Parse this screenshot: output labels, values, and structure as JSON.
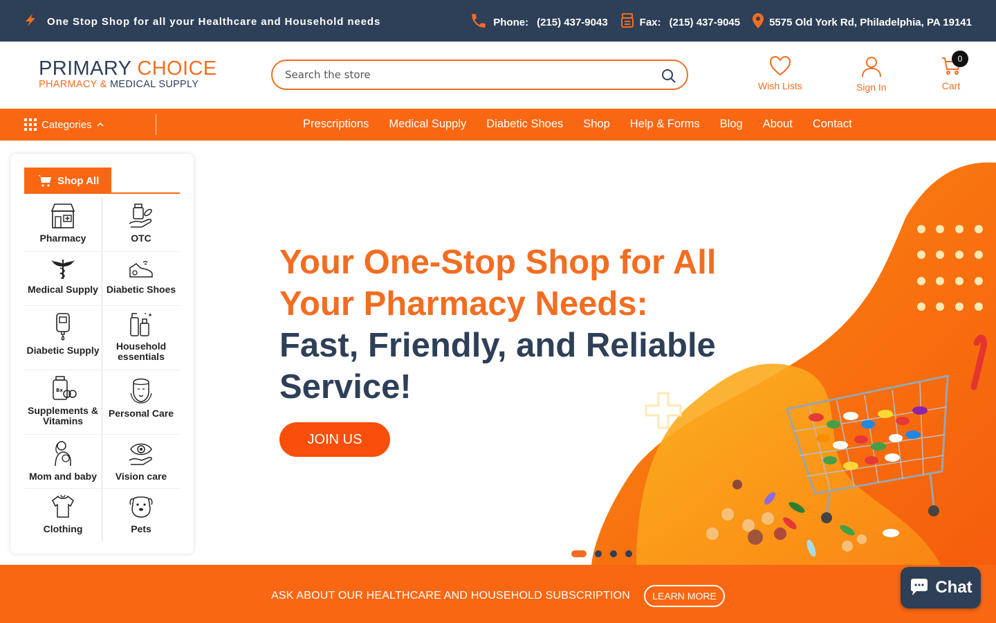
{
  "topbar": {
    "promo": "One Stop Shop for all your Healthcare and Household needs",
    "phone_label": "Phone:",
    "phone": "(215) 437-9043",
    "fax_label": "Fax:",
    "fax": "(215) 437-9045",
    "address": "5575 Old York Rd, Philadelphia, PA 19141"
  },
  "logo": {
    "line1_a": "PRIMARY",
    "line1_b": "CHOICE",
    "line2_a": "PHARMACY",
    "line2_amp": "&",
    "line2_b": "MEDICAL SUPPLY"
  },
  "search": {
    "placeholder": "Search the store"
  },
  "header": {
    "wishlist": "Wish Lists",
    "signin": "Sign In",
    "cart": "Cart",
    "cart_count": "0"
  },
  "nav": {
    "categories": "Categories",
    "links": [
      "Prescriptions",
      "Medical Supply",
      "Diabetic Shoes",
      "Shop",
      "Help & Forms",
      "Blog",
      "About",
      "Contact"
    ]
  },
  "sidebar": {
    "shop_all": "Shop All",
    "categories": [
      {
        "label": "Pharmacy",
        "icon": "pharmacy-store-icon"
      },
      {
        "label": "OTC",
        "icon": "pill-bottle-hand-icon"
      },
      {
        "label": "Medical Supply",
        "icon": "caduceus-icon"
      },
      {
        "label": "Diabetic Shoes",
        "icon": "shoe-icon"
      },
      {
        "label": "Diabetic Supply",
        "icon": "glucometer-icon"
      },
      {
        "label": "Household essentials",
        "icon": "cleaning-bottles-icon"
      },
      {
        "label": "Supplements & Vitamins",
        "icon": "supplements-jar-icon"
      },
      {
        "label": "Personal Care",
        "icon": "face-care-icon"
      },
      {
        "label": "Mom and baby",
        "icon": "mom-baby-icon"
      },
      {
        "label": "Vision care",
        "icon": "eye-care-icon"
      },
      {
        "label": "Clothing",
        "icon": "shirt-icon"
      },
      {
        "label": "Pets",
        "icon": "dog-icon"
      }
    ]
  },
  "hero": {
    "title_line1": "Your One-Stop Shop for All",
    "title_line2": "Your Pharmacy Needs:",
    "title_line3": "Fast, Friendly, and Reliable",
    "title_line4": "Service!",
    "cta": "JOIN US",
    "slides": 4,
    "active_slide": 1
  },
  "banner": {
    "text": "ASK ABOUT OUR HEALTHCARE AND HOUSEHOLD SUBSCRIPTION",
    "button": "LEARN MORE"
  },
  "chat": {
    "label": "Chat"
  },
  "colors": {
    "navy": "#2e3f58",
    "orange": "#f36d21",
    "nav_orange": "#fa6713"
  }
}
